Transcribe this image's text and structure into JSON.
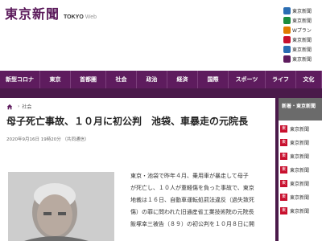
{
  "header": {
    "logo_jp": "東京新聞",
    "logo_en": "TOKYO",
    "logo_web": "Web"
  },
  "promo": [
    {
      "text": "東京新聞",
      "color": "#2a6db3"
    },
    {
      "text": "東京新聞",
      "color": "#1b8d3e"
    },
    {
      "text": "Wプラン",
      "color": "#e07b00"
    },
    {
      "text": "東京新聞",
      "color": "#c8102e"
    },
    {
      "text": "東京新聞",
      "color": "#2a6db3"
    },
    {
      "text": "東京新聞",
      "color": "#5e1c5e"
    }
  ],
  "nav": [
    {
      "label": "新型コロナ"
    },
    {
      "label": "東京"
    },
    {
      "label": "首都圏"
    },
    {
      "label": "社会"
    },
    {
      "label": "政治"
    },
    {
      "label": "経済"
    },
    {
      "label": "国際"
    },
    {
      "label": "スポーツ"
    },
    {
      "label": "ライフ"
    },
    {
      "label": "文化"
    }
  ],
  "breadcrumb": {
    "section": "社会"
  },
  "article": {
    "title": "母子死亡事故、１０月に初公判　池袋、車暴走の元院長",
    "date": "2020年9月16日 19時20分 （共同通信）",
    "body_lines": [
      "東京・池袋で昨年４月、乗用車が暴走して母子",
      "が死亡し、１０人が重軽傷を負った事故で、東京",
      "地裁は１６日、自動車運転処罰法違反（過失致死",
      "傷）の罪に問われた旧通産省工業技術院の元院長",
      "飯塚幸三被告（８９）の初公判を１０月８日に開"
    ]
  },
  "sidebar": {
    "heading": "新着・東京新聞",
    "items": [
      {
        "text": "東京新聞"
      },
      {
        "text": "東京新聞"
      },
      {
        "text": "東京新聞"
      },
      {
        "text": "東京新聞"
      },
      {
        "text": "東京新聞"
      },
      {
        "text": "東京新聞"
      },
      {
        "text": "東京新聞"
      }
    ]
  }
}
